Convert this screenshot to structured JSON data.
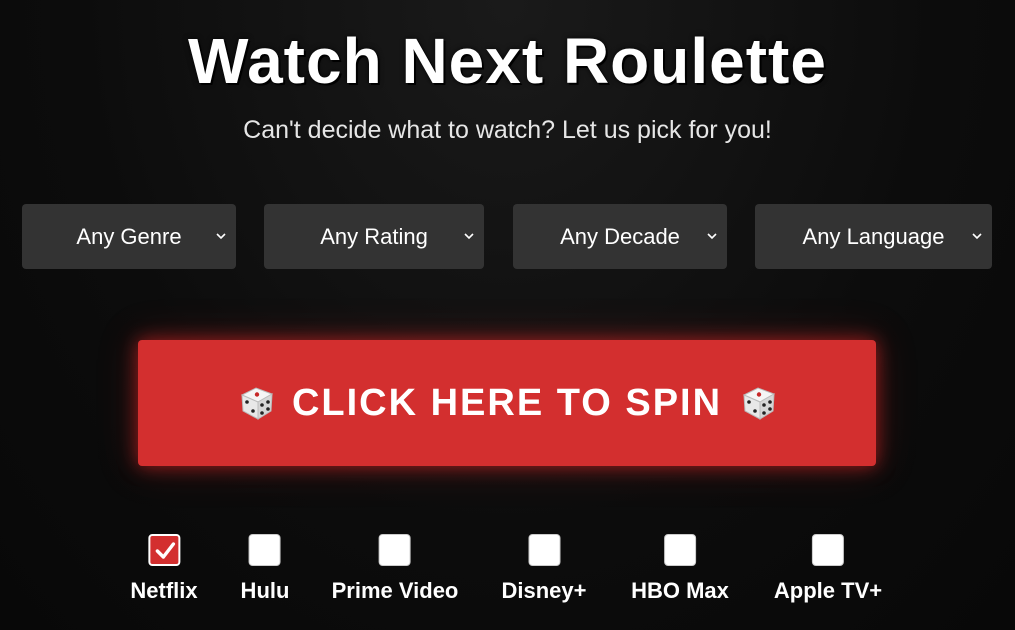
{
  "title": "Watch Next Roulette",
  "subtitle": "Can't decide what to watch? Let us pick for you!",
  "filters": [
    {
      "label": "Any Genre"
    },
    {
      "label": "Any Rating"
    },
    {
      "label": "Any Decade"
    },
    {
      "label": "Any Language"
    }
  ],
  "spin_button": {
    "label": "CLICK HERE TO SPIN",
    "icon": "dice-icon"
  },
  "services": [
    {
      "label": "Netflix",
      "checked": true
    },
    {
      "label": "Hulu",
      "checked": false
    },
    {
      "label": "Prime Video",
      "checked": false
    },
    {
      "label": "Disney+",
      "checked": false
    },
    {
      "label": "HBO Max",
      "checked": false
    },
    {
      "label": "Apple TV+",
      "checked": false
    }
  ],
  "colors": {
    "accent": "#d32f2f",
    "select_bg": "#333333",
    "background": "#0b0b0b"
  }
}
